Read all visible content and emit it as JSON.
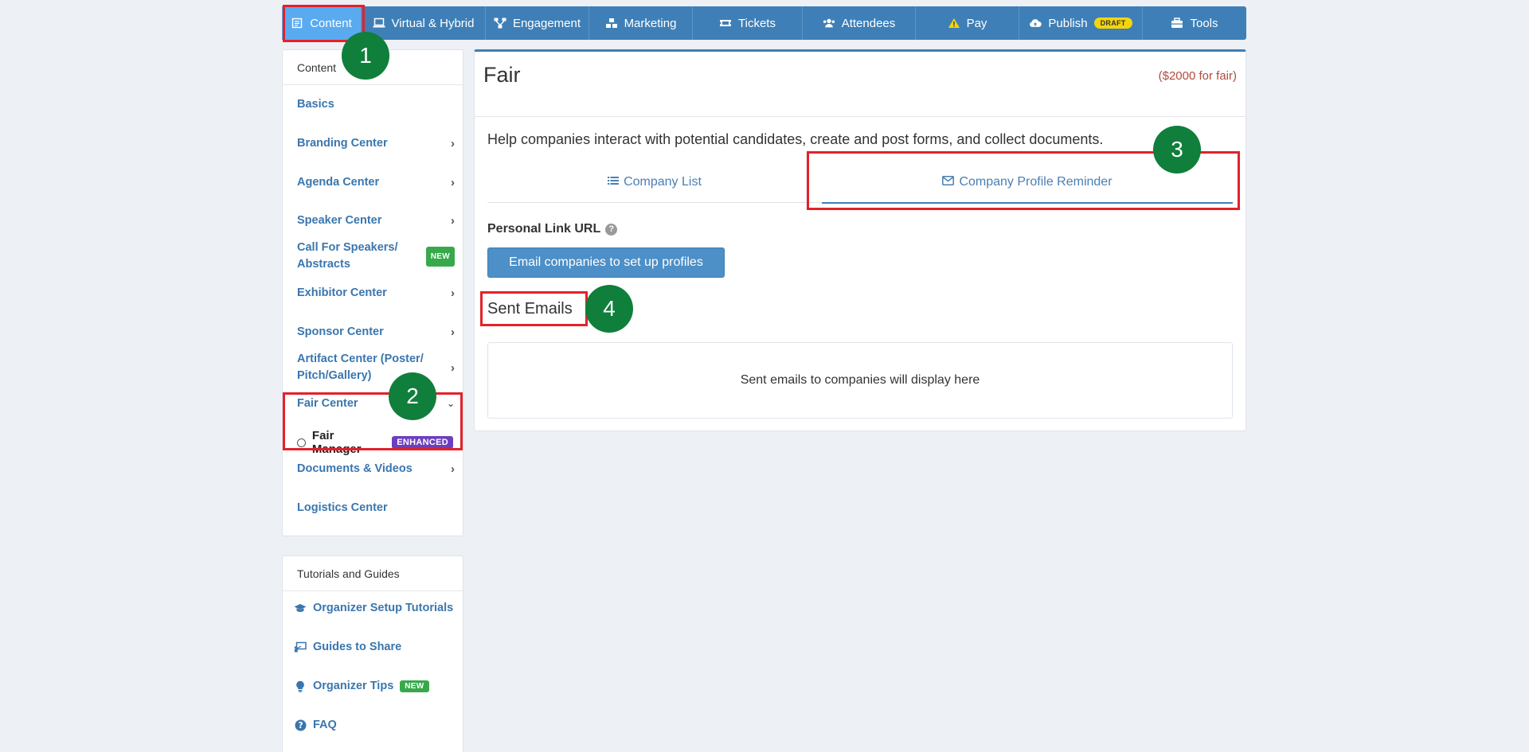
{
  "topnav": {
    "items": [
      {
        "label": "Content",
        "icon": "document-icon",
        "active": true
      },
      {
        "label": "Virtual & Hybrid",
        "icon": "laptop-icon"
      },
      {
        "label": "Engagement",
        "icon": "sitemap-icon"
      },
      {
        "label": "Marketing",
        "icon": "cubes-icon"
      },
      {
        "label": "Tickets",
        "icon": "ticket-icon"
      },
      {
        "label": "Attendees",
        "icon": "users-icon"
      },
      {
        "label": "Pay",
        "icon": "warning-icon"
      },
      {
        "label": "Publish",
        "icon": "cloud-upload-icon",
        "badge": "DRAFT"
      },
      {
        "label": "Tools",
        "icon": "toolbox-icon"
      }
    ]
  },
  "sidebar": {
    "header": "Content",
    "items": [
      {
        "label": "Basics"
      },
      {
        "label": "Branding Center"
      },
      {
        "label": "Agenda Center"
      },
      {
        "label": "Speaker Center"
      },
      {
        "label": "Call For Speakers/ Abstracts",
        "badge": "NEW"
      },
      {
        "label": "Exhibitor Center"
      },
      {
        "label": "Sponsor Center"
      },
      {
        "label": "Artifact Center (Poster/ Pitch/Gallery)"
      },
      {
        "label": "Fair Center"
      },
      {
        "label": "Documents & Videos"
      },
      {
        "label": "Logistics Center"
      }
    ],
    "subitem": {
      "label": "Fair Manager",
      "badge": "ENHANCED"
    }
  },
  "guides": {
    "header": "Tutorials and Guides",
    "items": [
      {
        "label": "Organizer Setup Tutorials",
        "icon": "graduation-cap-icon"
      },
      {
        "label": "Guides to Share",
        "icon": "chalkboard-icon"
      },
      {
        "label": "Organizer Tips",
        "icon": "lightbulb-icon",
        "badge": "NEW"
      },
      {
        "label": "FAQ",
        "icon": "question-circle-icon"
      }
    ]
  },
  "main": {
    "title": "Fair",
    "price": "($2000 for fair)",
    "intro": "Help companies interact with potential candidates, create and post forms, and collect documents.",
    "tabs": [
      {
        "label": "Company List",
        "icon": "list-icon"
      },
      {
        "label": "Company Profile Reminder",
        "icon": "envelope-icon",
        "active": true
      }
    ],
    "personal_link_label": "Personal Link URL",
    "email_button": "Email companies to set up profiles",
    "sent_title": "Sent Emails",
    "sent_empty": "Sent emails to companies will display here"
  },
  "markers": [
    "1",
    "2",
    "3",
    "4"
  ],
  "colors": {
    "nav_bg": "#3f7fb7",
    "nav_active": "#5aaaf0",
    "link": "#3a76ae",
    "highlight": "#e3212a",
    "marker": "#0f7f3b",
    "new_badge": "#37a94a",
    "enhanced_badge": "#6c3fbf",
    "draft_badge": "#f4d50b",
    "price": "#b14b3c"
  }
}
